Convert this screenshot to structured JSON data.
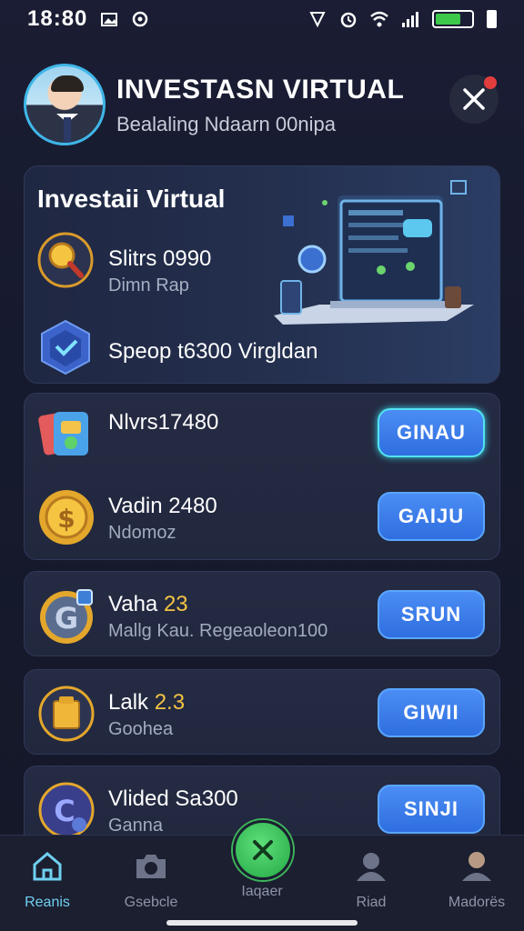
{
  "status_bar": {
    "time": "18:80"
  },
  "header": {
    "title": "INVESTASN VIRTUAL",
    "subtitle": "Bealaling Ndaarn 00nipa"
  },
  "hero": {
    "title": "Investaii Virtual",
    "row1": {
      "title": "Slitrs 0990",
      "subtitle": "Dimn Rap"
    },
    "row2": {
      "title": "Speop t6300 Virgldan"
    }
  },
  "items": [
    {
      "title": "Nlvrs17480",
      "subtitle": "",
      "button": "GINAU",
      "icon": "apps-icon"
    },
    {
      "title": "Vadin 2480",
      "subtitle": "Ndomoz",
      "button": "GAIJU",
      "icon": "coin-icon"
    },
    {
      "title_plain": "Vaha ",
      "title_highlight": "23",
      "subtitle": "Mallg Kau. Regeaoleon100",
      "button": "SRUN",
      "icon": "g-badge-icon"
    },
    {
      "title_plain": "Lalk ",
      "title_highlight": "2.3",
      "subtitle": "Goohea",
      "button": "GIWII",
      "icon": "box-icon"
    },
    {
      "title": "Vlided Sa300",
      "subtitle": "Ganna",
      "button": "SINJI",
      "icon": "c-badge-icon"
    }
  ],
  "bottom_nav": [
    {
      "label": "Reanis",
      "icon": "home-icon",
      "active": true
    },
    {
      "label": "Gsebcle",
      "icon": "camera-icon",
      "active": false
    },
    {
      "label": "Iaqaer",
      "icon": "close-icon",
      "active": false
    },
    {
      "label": "Riad",
      "icon": "person-icon",
      "active": false
    },
    {
      "label": "Madorës",
      "icon": "user-icon",
      "active": false
    }
  ],
  "colors": {
    "accent": "#3fb6e8",
    "button": "#2f6ee0",
    "fab": "#22a845",
    "highlight": "#f2c344"
  }
}
